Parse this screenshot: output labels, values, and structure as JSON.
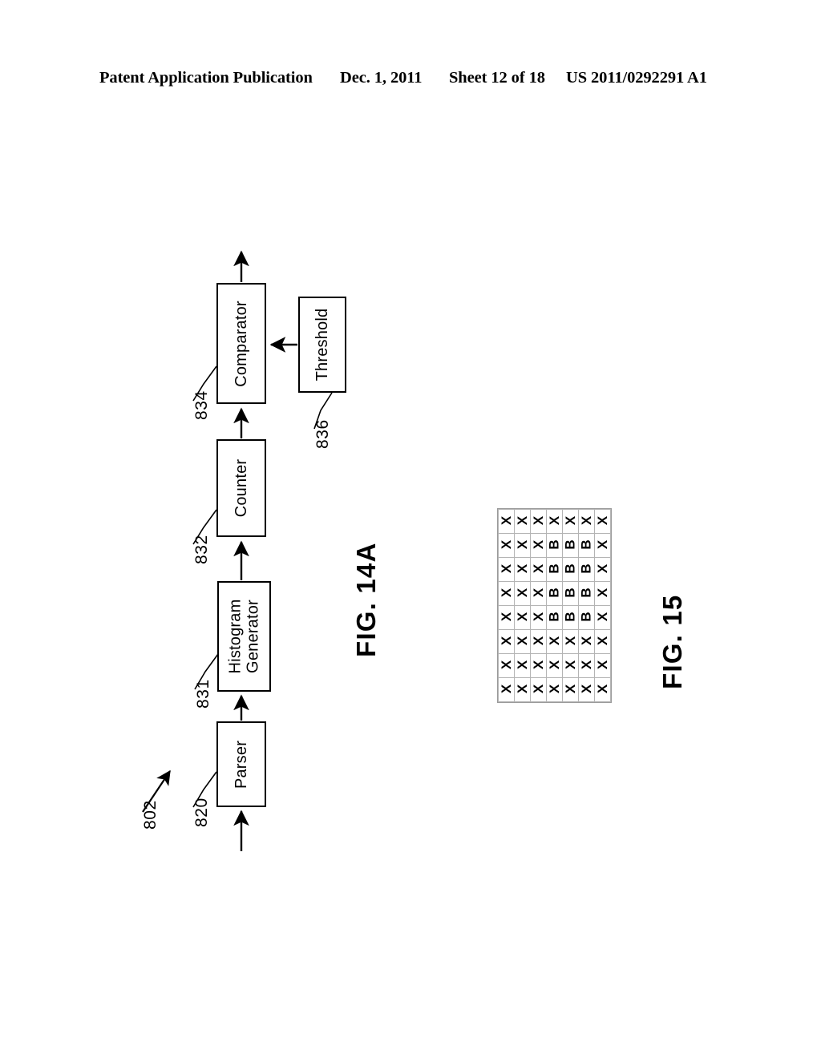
{
  "header": {
    "publication": "Patent Application Publication",
    "date": "Dec. 1, 2011",
    "sheet": "Sheet 12 of 18",
    "document_number": "US 2011/0292291 A1"
  },
  "figures": [
    {
      "id": "fig14a",
      "label": "FIG. 14A",
      "system_ref": "802",
      "blocks": [
        {
          "ref": "820",
          "label": "Parser"
        },
        {
          "ref": "831",
          "label": "Histogram Generator",
          "line1": "Histogram",
          "line2": "Generator"
        },
        {
          "ref": "832",
          "label": "Counter"
        },
        {
          "ref": "834",
          "label": "Comparator"
        },
        {
          "ref": "836",
          "label": "Threshold"
        }
      ],
      "connections": [
        {
          "from": "input",
          "to": "820"
        },
        {
          "from": "820",
          "to": "831"
        },
        {
          "from": "831",
          "to": "832"
        },
        {
          "from": "832",
          "to": "834"
        },
        {
          "from": "836",
          "to": "834"
        },
        {
          "from": "834",
          "to": "output"
        }
      ]
    },
    {
      "id": "fig15",
      "label": "FIG. 15",
      "grid": {
        "rows": 8,
        "cols": 7,
        "cells": [
          [
            "X",
            "X",
            "X",
            "X",
            "X",
            "X",
            "X"
          ],
          [
            "X",
            "X",
            "X",
            "B",
            "B",
            "B",
            "X"
          ],
          [
            "X",
            "X",
            "X",
            "B",
            "B",
            "B",
            "X"
          ],
          [
            "X",
            "X",
            "X",
            "B",
            "B",
            "B",
            "X"
          ],
          [
            "X",
            "X",
            "X",
            "B",
            "B",
            "B",
            "X"
          ],
          [
            "X",
            "X",
            "X",
            "X",
            "X",
            "X",
            "X"
          ],
          [
            "X",
            "X",
            "X",
            "X",
            "X",
            "X",
            "X"
          ],
          [
            "X",
            "X",
            "X",
            "X",
            "X",
            "X",
            "X"
          ]
        ]
      }
    }
  ],
  "colors": {
    "ink": "#000000",
    "paper": "#ffffff",
    "grid_line": "#b4b4b4",
    "grid_border": "#9a9a9a"
  }
}
